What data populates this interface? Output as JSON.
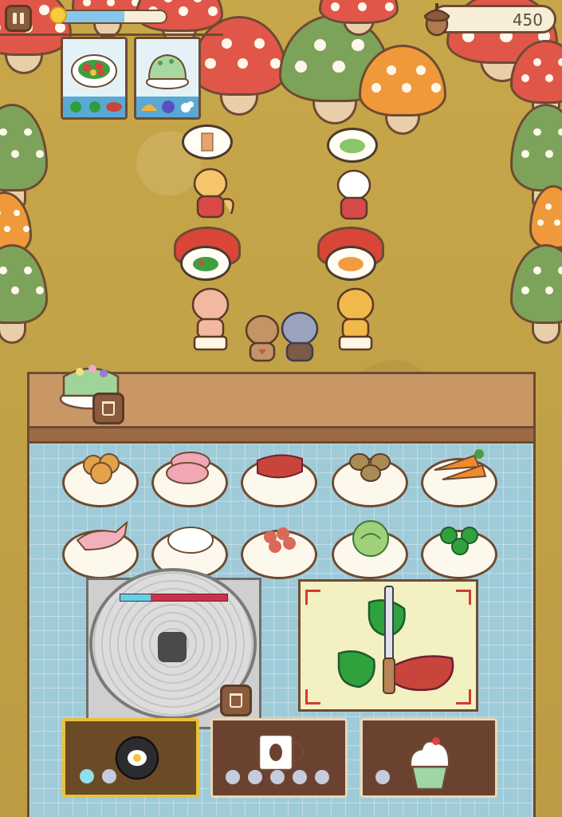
{
  "hud": {
    "coins": "450",
    "day_progress": 0.62,
    "icons": {
      "pause": "pause-icon",
      "sun": "sun-icon",
      "acorn": "acorn-icon"
    }
  },
  "orders": [
    {
      "dish": "vegetable-salad",
      "ingredients": [
        "pepper-icon",
        "pepper-icon",
        "meat-icon"
      ]
    },
    {
      "dish": "green-cake",
      "ingredients": [
        "taco-icon",
        "blue-berry-icon",
        "cream-icon"
      ]
    }
  ],
  "customers": [
    {
      "animal": "fox",
      "wants": "drink-bubble"
    },
    {
      "animal": "cat",
      "wants": "salad-bubble"
    },
    {
      "animal": "pig",
      "wants": "salad-bubble"
    },
    {
      "animal": "hamster",
      "wants": "omelette-bubble"
    }
  ],
  "staff": [
    "bear-chef",
    "raccoon-chef"
  ],
  "ingredients": [
    "onion",
    "ham",
    "beef",
    "potato",
    "carrot",
    "chicken-leg",
    "rice",
    "shrimp",
    "cabbage",
    "green-pepper"
  ],
  "stove": {
    "cook_progress": 0.28
  },
  "cutting_board": [
    "green-pepper",
    "green-pepper",
    "beef",
    "knife"
  ],
  "appliances": [
    {
      "name": "frying-pan",
      "level_pips": 2,
      "level_on": 1,
      "active": true
    },
    {
      "name": "coffee-machine",
      "level_pips": 5,
      "level_on": 0,
      "active": false
    },
    {
      "name": "cupcake-oven",
      "level_pips": 1,
      "level_on": 0,
      "active": false
    }
  ],
  "colors": {
    "accent": "#e8c23a",
    "tile": "#9fcbd8",
    "counter": "#c99766",
    "brand_red": "#d43b2e"
  }
}
